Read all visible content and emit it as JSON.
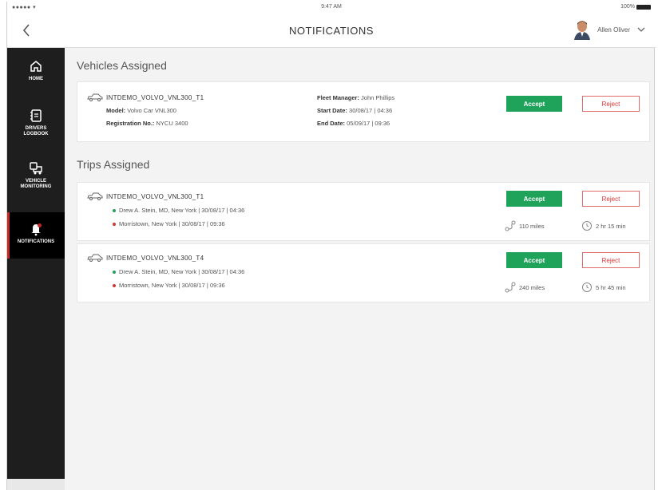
{
  "status_bar": {
    "signal": "●●●●● ▾",
    "time": "9:47 AM",
    "battery": "100%"
  },
  "header": {
    "title": "NOTIFICATIONS",
    "user_name": "Allen Oliver"
  },
  "sidebar": {
    "items": [
      {
        "label": "HOME",
        "icon": "home-icon"
      },
      {
        "label": "DRIVERS LOGBOOK",
        "icon": "logbook-icon"
      },
      {
        "label": "VEHICLE MONITORING",
        "icon": "vehicle-monitoring-icon"
      },
      {
        "label": "NOTIFICATIONS",
        "icon": "bell-icon",
        "active": true
      }
    ]
  },
  "vehicles": {
    "title": "Vehicles Assigned",
    "items": [
      {
        "name": "INTDEMO_VOLVO_VNL300_T1",
        "model_label": "Model:",
        "model_value": "Volvo Car VNL300",
        "reg_label": "Registration No.:",
        "reg_value": "NYCU 3400",
        "manager_label": "Fleet Manager:",
        "manager_value": "John Phillips",
        "start_label": "Start Date:",
        "start_value": "30/08/17  |  04:36",
        "end_label": "End Date:",
        "end_value": "05/09/17  |  09:36",
        "accept": "Accept",
        "reject": "Reject"
      }
    ]
  },
  "trips": {
    "title": "Trips Assigned",
    "items": [
      {
        "name": "INTDEMO_VOLVO_VNL300_T1",
        "from": "Drew A. Stein, MD, New York  |  30/08/17  |  04:36",
        "to": "Morristown, New York  |  30/08/17  |  09:36",
        "distance": "110 miles",
        "duration": "2 hr 15 min",
        "accept": "Accept",
        "reject": "Reject"
      },
      {
        "name": "INTDEMO_VOLVO_VNL300_T4",
        "from": "Drew A. Stein, MD, New York  |  30/08/17  |  04:36",
        "to": "Morristown, New York  |  30/08/17  |  09:36",
        "distance": "240 miles",
        "duration": "5 hr 45 min",
        "accept": "Accept",
        "reject": "Reject"
      }
    ]
  },
  "colors": {
    "accept": "#1fa35a",
    "reject": "#d33333",
    "sidebar": "#1e1e1e",
    "from_dot": "#1fa35a",
    "to_dot": "#d33333"
  }
}
